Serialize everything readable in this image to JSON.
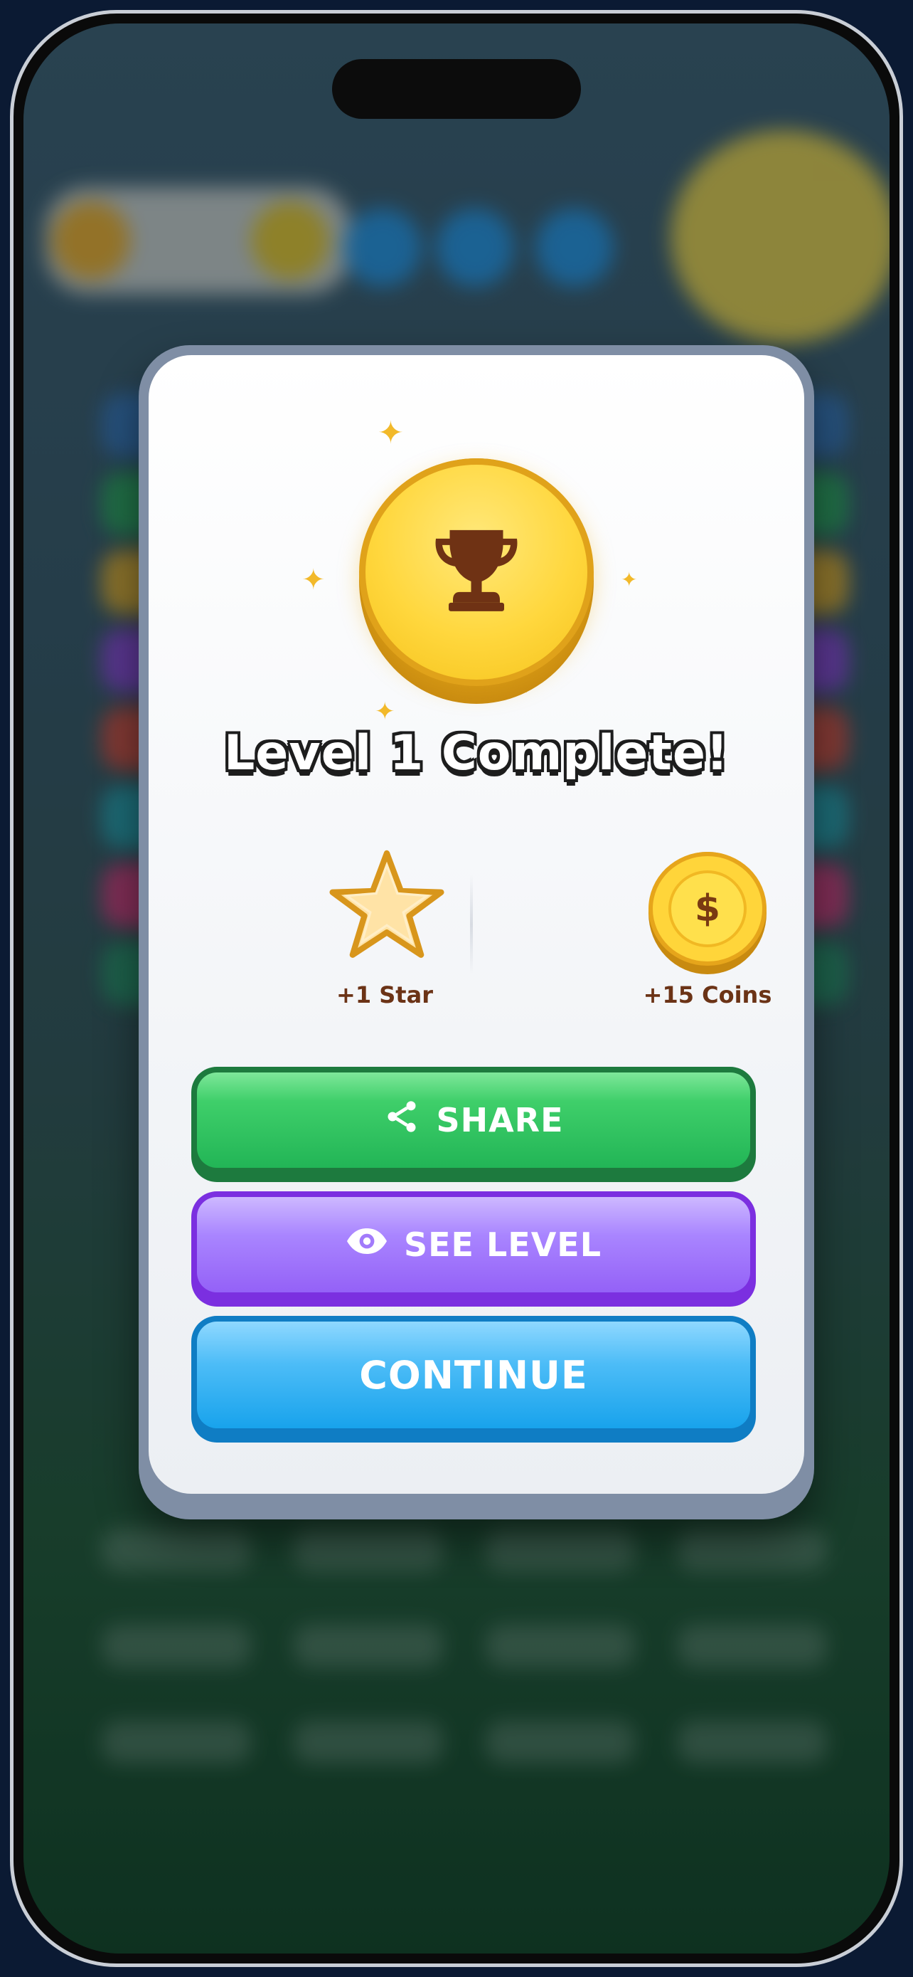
{
  "modal": {
    "title": "Level 1 Complete!",
    "rewards": [
      {
        "label": "+1 Star",
        "icon": "star-icon"
      },
      {
        "label": "+15 Coins",
        "icon": "coin-icon",
        "symbol": "$"
      }
    ]
  },
  "buttons": {
    "share": "SHARE",
    "see_level": "SEE LEVEL",
    "continue": "CONTINUE"
  },
  "colors": {
    "share": "#22b556",
    "see_level": "#9461f7",
    "continue": "#18a3ec",
    "coin": "#ffd73d",
    "label_brown": "#6b3316"
  }
}
